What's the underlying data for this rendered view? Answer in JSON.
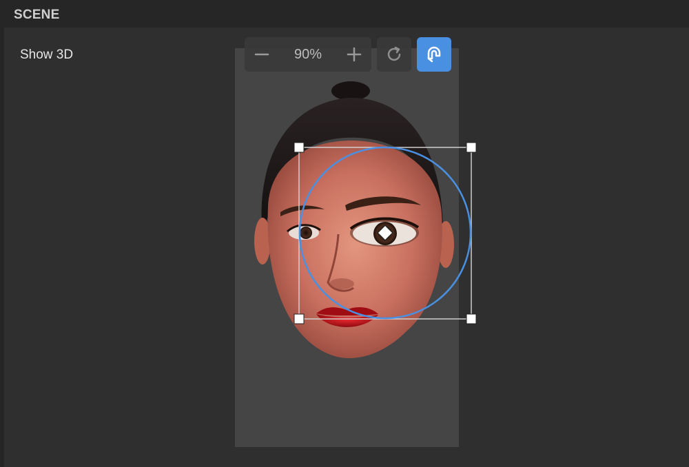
{
  "header": {
    "title": "SCENE"
  },
  "viewport": {
    "show3d_label": "Show 3D"
  },
  "toolbar": {
    "zoom_out_icon": "minus-icon",
    "zoom_value": "90%",
    "zoom_in_icon": "plus-icon",
    "reset_icon": "rotate-reset-icon",
    "magnet_icon": "magnet-snap-icon"
  },
  "colors": {
    "background": "#2c2c2c",
    "header": "#262626",
    "canvas": "#454545",
    "accent": "#4a90e2",
    "lips": "#c0111b"
  }
}
